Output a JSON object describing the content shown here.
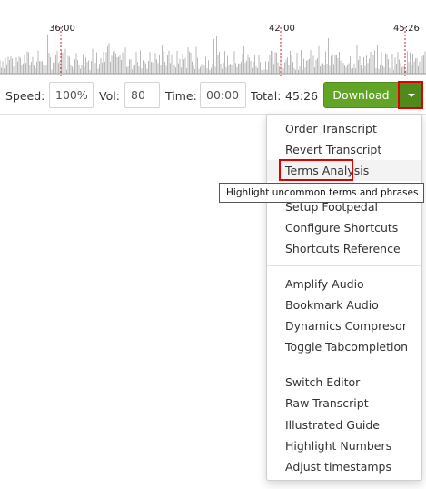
{
  "waveform": {
    "time_markers": [
      "36:00",
      "42:00",
      "45:26"
    ],
    "wave_color": "#b9b9b9",
    "marker_color": "#cc2222"
  },
  "controls": {
    "speed_label": "Speed:",
    "speed_value": "100%",
    "vol_label": "Vol:",
    "vol_value": "80",
    "time_label": "Time:",
    "time_value": "00:00",
    "total_label": "Total:",
    "total_value": "45:26",
    "download_label": "Download",
    "accent": "#62a426"
  },
  "menu": {
    "groups": [
      [
        "Order Transcript",
        "Revert Transcript",
        "Terms Analysis",
        "Setup Footpedal",
        "Configure Shortcuts",
        "Shortcuts Reference"
      ],
      [
        "Amplify Audio",
        "Bookmark Audio",
        "Dynamics Compresor",
        "Toggle Tabcompletion"
      ],
      [
        "Switch Editor",
        "Raw Transcript",
        "Illustrated Guide",
        "Highlight Numbers",
        "Adjust timestamps"
      ]
    ]
  },
  "tooltip": {
    "text": "Highlight uncommon terms and phrases"
  }
}
